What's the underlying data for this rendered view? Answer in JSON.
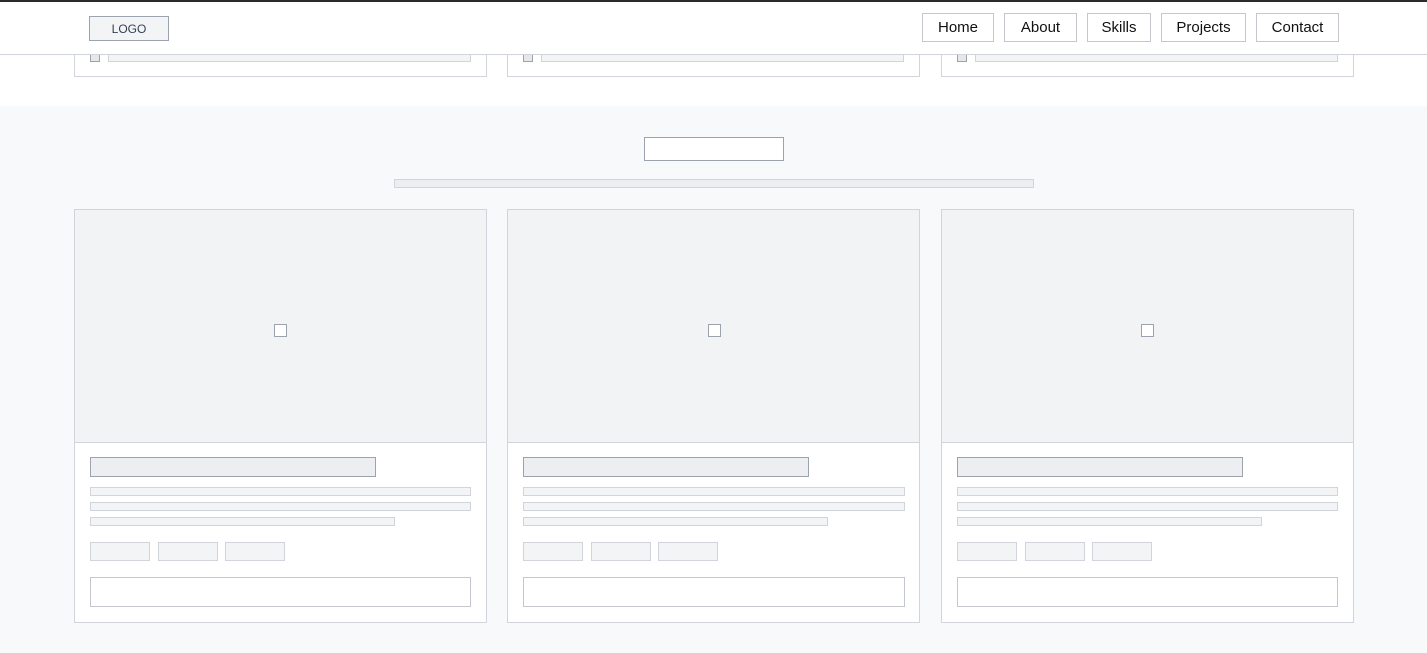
{
  "header": {
    "logo_label": "LOGO",
    "nav": [
      {
        "label": "Home"
      },
      {
        "label": "About"
      },
      {
        "label": "Skills"
      },
      {
        "label": "Projects"
      },
      {
        "label": "Contact"
      }
    ]
  },
  "colors": {
    "page_bg": "#ffffff",
    "section_bg": "#f8f9fa",
    "border": "#d1d5db",
    "placeholder_fill": "#f3f4f6",
    "text": "#111111"
  },
  "placeholder_icons": [
    "checkbox-icon",
    "image-placeholder-icon"
  ],
  "top_cards_count_visible": 3,
  "projects": {
    "cards": [
      {
        "media_icon": "image-placeholder-icon",
        "tags": 3
      },
      {
        "media_icon": "image-placeholder-icon",
        "tags": 3
      },
      {
        "media_icon": "image-placeholder-icon",
        "tags": 3
      }
    ]
  }
}
